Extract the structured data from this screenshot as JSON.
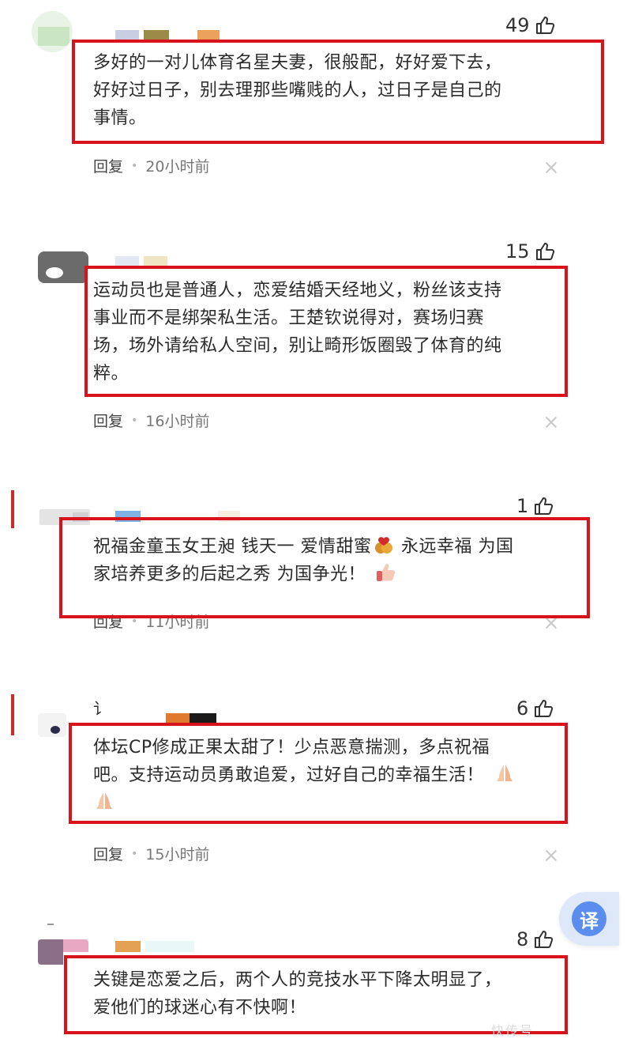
{
  "comments": [
    {
      "likes": "49",
      "text": "多好的一对儿体育名星夫妻，很般配，好好爱下去，好好过日子，别去理那些嘴贱的人，过日子是自己的事情。",
      "lines": [
        "多好的一对儿体育名星夫妻，很般配，好好爱下去，",
        "好好过日子，别去理那些嘴贱的人，过日子是自己的",
        "事情。"
      ],
      "reply_label": "回复",
      "time": "20小时前"
    },
    {
      "likes": "15",
      "lines": [
        "运动员也是普通人，恋爱结婚天经地义，粉丝该支持",
        "事业而不是绑架私生活。王楚钦说得对，赛场归赛",
        "场，场外请给私人空间，别让畸形饭圈毁了体育的纯",
        "粹。"
      ],
      "reply_label": "回复",
      "time": "16小时前"
    },
    {
      "likes": "1",
      "lines": [
        "祝福金童玉女王昶 钱天一 爱情甜蜜",
        " 永远幸福 为国",
        "家培养更多的后起之秀 为国争光！"
      ],
      "reply_label": "回复",
      "time": "11小时前"
    },
    {
      "likes": "6",
      "name_fragment": "讠",
      "lines": [
        "体坛CP修成正果太甜了！少点恶意揣测，多点祝福",
        "吧。支持运动员勇敢追爱，过好自己的幸福生活！"
      ],
      "reply_label": "回复",
      "time": "15小时前"
    },
    {
      "likes": "8",
      "lines": [
        "关键是恋爱之后，两个人的竞技水平下降太明显了，",
        "爱他们的球迷心有不快啊！"
      ]
    }
  ],
  "translate_button": "译",
  "watermark": "快传号",
  "icons": {
    "like": "thumbs-up-icon",
    "close": "close-icon",
    "heart_emoji": "heart-emoji-icon",
    "thumbs_up_emoji": "thumbs-up-emoji-icon",
    "pray_emoji": "pray-emoji-icon"
  },
  "colors": {
    "highlight_border": "#d8131c",
    "translate_accent": "#5b8def"
  }
}
